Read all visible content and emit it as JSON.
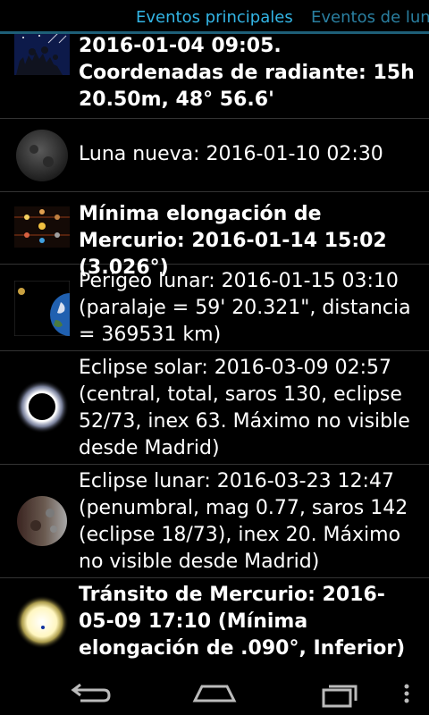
{
  "tabs": {
    "active": "Eventos principales",
    "inactive": "Eventos de lun"
  },
  "events": [
    {
      "text": "2016-01-04 09:05. Coordenadas de radiante: 15h 20.50m, 48° 56.6'",
      "bold": true,
      "icon": "meteor-shower-icon"
    },
    {
      "text": "Luna nueva: 2016-01-10 02:30",
      "bold": false,
      "icon": "new-moon-icon"
    },
    {
      "text": "Mínima elongación de Mercurio: 2016-01-14 15:02 (3.026°)",
      "bold": true,
      "icon": "planet-elongation-icon"
    },
    {
      "text": "Perigeo lunar: 2016-01-15 03:10 (paralaje = 59' 20.321\", distancia = 369531 km)",
      "bold": false,
      "icon": "earth-moon-icon"
    },
    {
      "text": "Eclipse solar: 2016-03-09 02:57 (central, total, saros 130, eclipse 52/73, inex 63. Máximo no visible desde Madrid)",
      "bold": false,
      "icon": "solar-eclipse-icon"
    },
    {
      "text": "Eclipse lunar: 2016-03-23 12:47 (penumbral, mag 0.77, saros 142 (eclipse 18/73), inex 20. Máximo no visible desde Madrid)",
      "bold": false,
      "icon": "lunar-eclipse-icon"
    },
    {
      "text": "Tránsito de Mercurio: 2016-05-09 17:10 (Mínima elongación de .090°, Inferior)",
      "bold": true,
      "icon": "sun-transit-icon"
    }
  ],
  "navbar": {
    "back": "back-icon",
    "home": "home-icon",
    "recents": "recents-icon",
    "menu": "overflow-menu-icon"
  }
}
